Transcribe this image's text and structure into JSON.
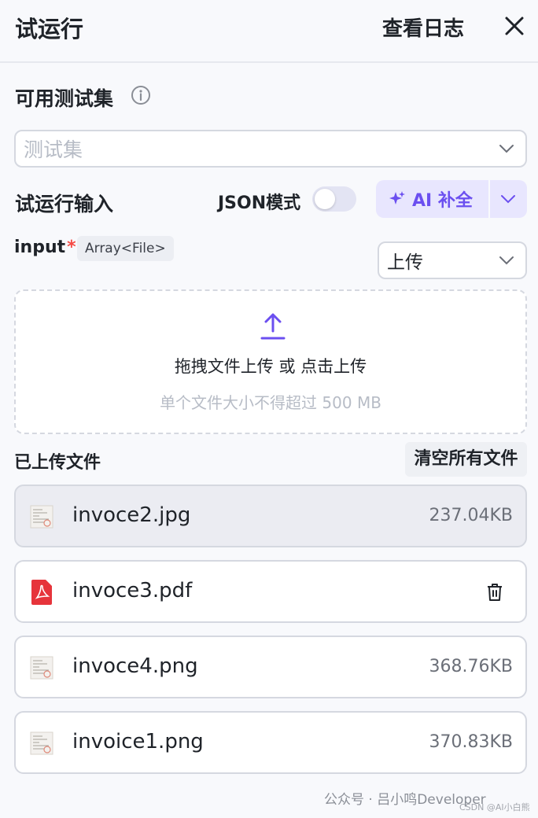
{
  "header": {
    "title": "试运行",
    "view_log_label": "查看日志",
    "close_icon": "close-icon"
  },
  "dataset": {
    "label": "可用测试集",
    "info_icon": "info-icon",
    "placeholder": "测试集"
  },
  "run_input": {
    "label": "试运行输入",
    "json_mode_label": "JSON模式",
    "json_mode_on": false,
    "ai_fill_label": "AI 补全",
    "accent_color": "#6b4ff0"
  },
  "input_field": {
    "name": "input",
    "required_mark": "*",
    "type_tag": "Array<File>",
    "source_select_value": "上传"
  },
  "dropzone": {
    "main_text": "拖拽文件上传 或 点击上传",
    "hint_text": "单个文件大小不得超过 500 MB",
    "icon": "upload-icon"
  },
  "uploaded": {
    "label": "已上传文件",
    "clear_all_label": "清空所有文件",
    "files": [
      {
        "name": "invoce2.jpg",
        "size": "237.04KB",
        "kind": "image"
      },
      {
        "name": "invoce3.pdf",
        "size": "",
        "kind": "pdf"
      },
      {
        "name": "invoce4.png",
        "size": "368.76KB",
        "kind": "image"
      },
      {
        "name": "invoice1.png",
        "size": "370.83KB",
        "kind": "image"
      }
    ]
  },
  "watermark": {
    "line1": "公众号 · 吕小鸣Developer",
    "line2": "CSDN @AI小白熊"
  }
}
